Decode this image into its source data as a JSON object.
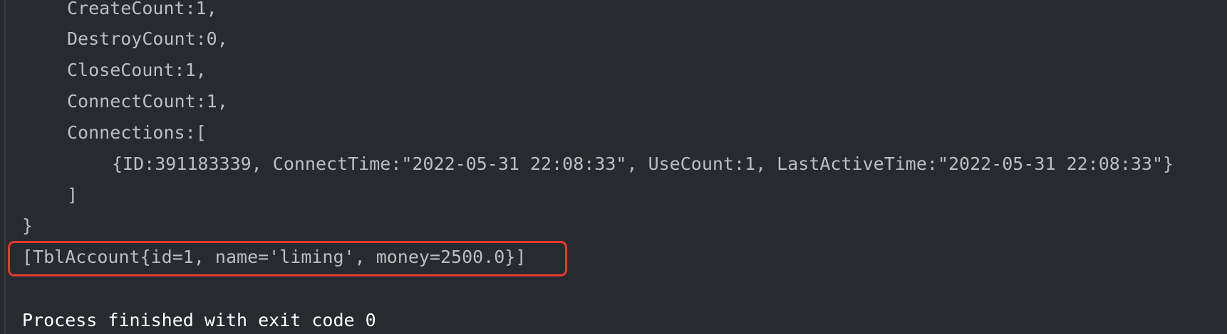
{
  "console": {
    "lines": [
      "CreateCount:1,",
      "DestroyCount:0,",
      "CloseCount:1,",
      "ConnectCount:1,",
      "Connections:[",
      "{ID:391183339, ConnectTime:\"2022-05-31 22:08:33\", UseCount:1, LastActiveTime:\"2022-05-31 22:08:33\"}",
      "]",
      "}",
      "[TblAccount{id=1, name='liming', money=2500.0}]",
      "Process finished with exit code 0"
    ]
  },
  "colors": {
    "background": "#282a31",
    "text": "#bcbec4",
    "highlight_border": "#e8392b"
  }
}
